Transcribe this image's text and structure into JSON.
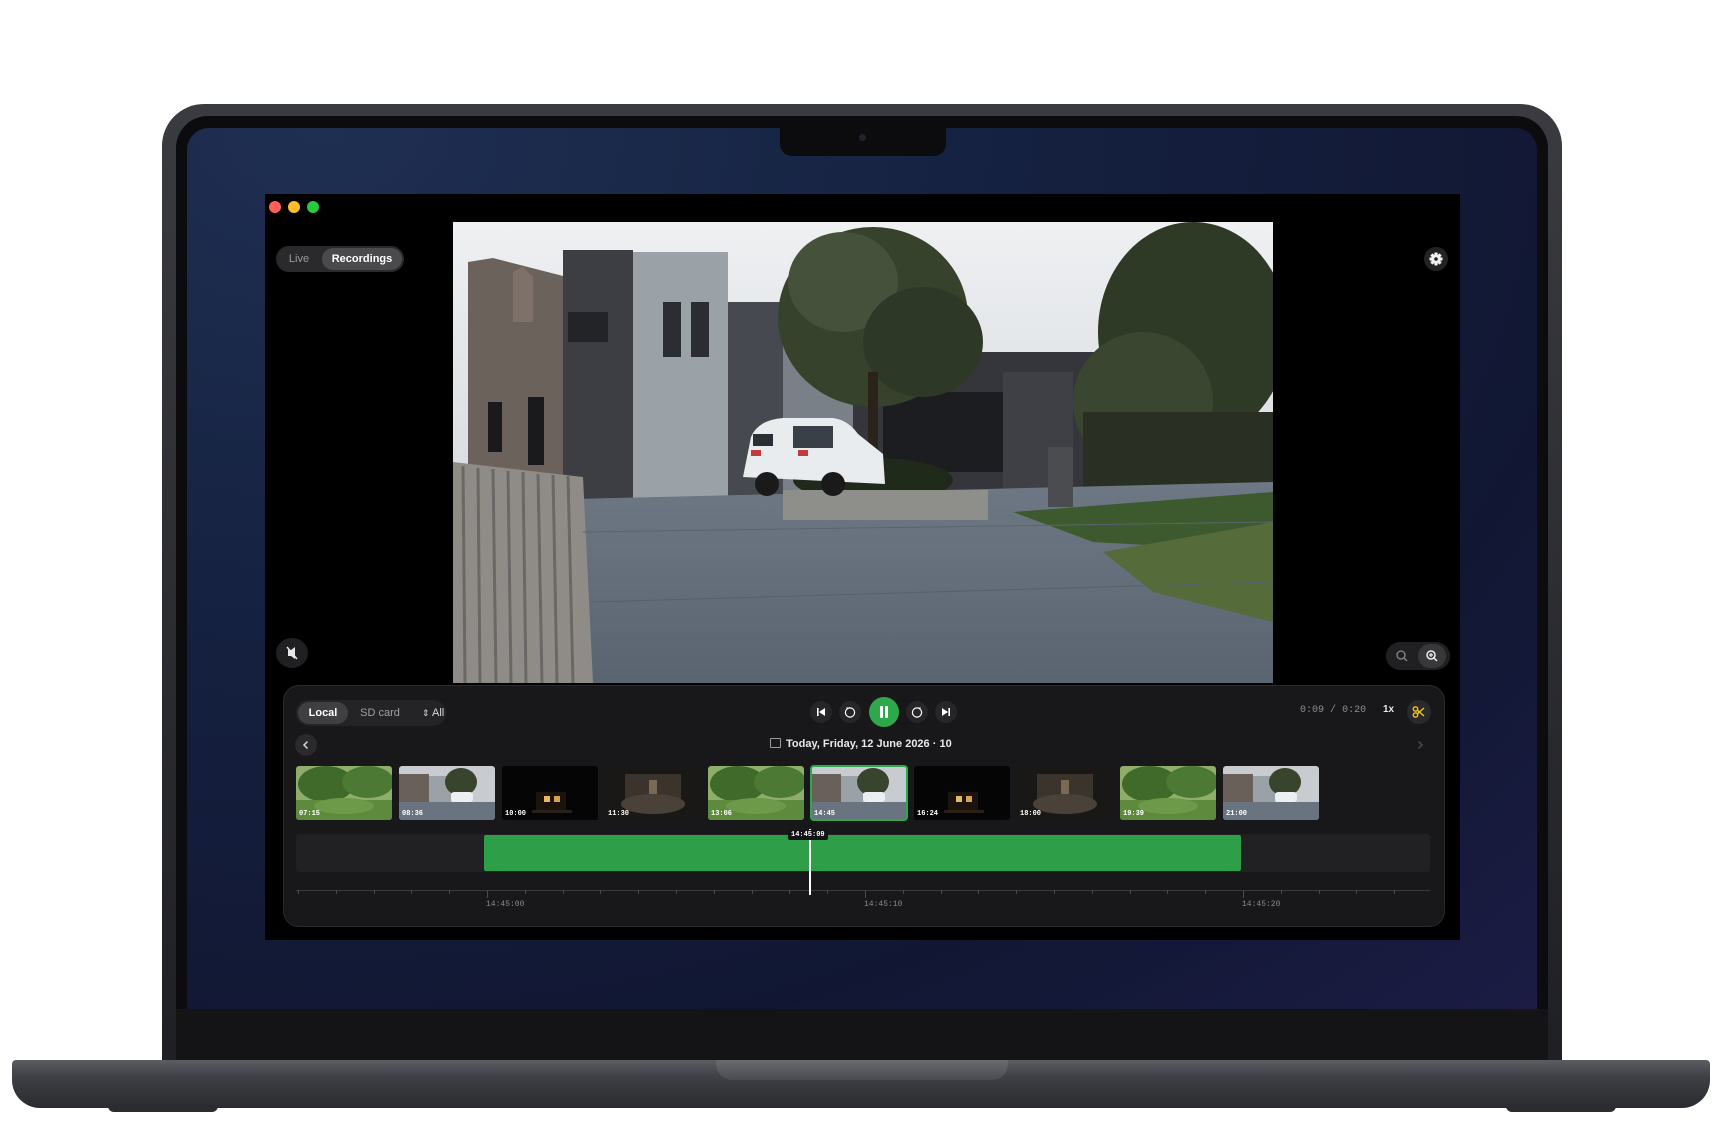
{
  "window": {
    "traffic_lights": [
      "#ff5f57",
      "#febc2e",
      "#28c840"
    ]
  },
  "view_toggle": {
    "options": [
      "Live",
      "Recordings"
    ],
    "selected": "Recordings"
  },
  "icons": {
    "settings": "gear-icon",
    "mute": "speaker-mute-icon",
    "zoom_out": "zoom-out-icon",
    "zoom_in": "zoom-in-icon",
    "clip": "scissors-icon"
  },
  "source_tabs": {
    "options": [
      "Local",
      "SD card"
    ],
    "selected": "Local"
  },
  "filter": {
    "label": "All",
    "icon": "up-down-chevron-icon"
  },
  "playback": {
    "controls": [
      "skip-back-icon",
      "rewind-10-icon",
      "pause-icon",
      "forward-10-icon",
      "skip-forward-icon"
    ],
    "state": "playing",
    "time_current": "0:09",
    "time_separator": "/",
    "time_total": "0:20",
    "speed": "1x"
  },
  "date_nav": {
    "label": "Today, Friday, 12 June 2026 · 10",
    "prev": "chevron-left-icon",
    "next": "chevron-right-icon"
  },
  "thumbnails": [
    {
      "time": "07:15",
      "scene": "garden"
    },
    {
      "time": "08:36",
      "scene": "driveway"
    },
    {
      "time": "10:00",
      "scene": "night-house"
    },
    {
      "time": "11:30",
      "scene": "dim-room"
    },
    {
      "time": "13:06",
      "scene": "garden"
    },
    {
      "time": "14:45",
      "scene": "driveway",
      "selected": true
    },
    {
      "time": "16:24",
      "scene": "night-house"
    },
    {
      "time": "18:00",
      "scene": "dim-room"
    },
    {
      "time": "19:39",
      "scene": "garden"
    },
    {
      "time": "21:00",
      "scene": "driveway"
    }
  ],
  "timeline": {
    "playhead_label": "14:45:09",
    "tick_labels": [
      "14:45:00",
      "14:45:10",
      "14:45:20"
    ],
    "clip_color": "#2e9e48"
  },
  "colors": {
    "accent": "#2ea84a",
    "clip_accent": "#f5c518"
  }
}
